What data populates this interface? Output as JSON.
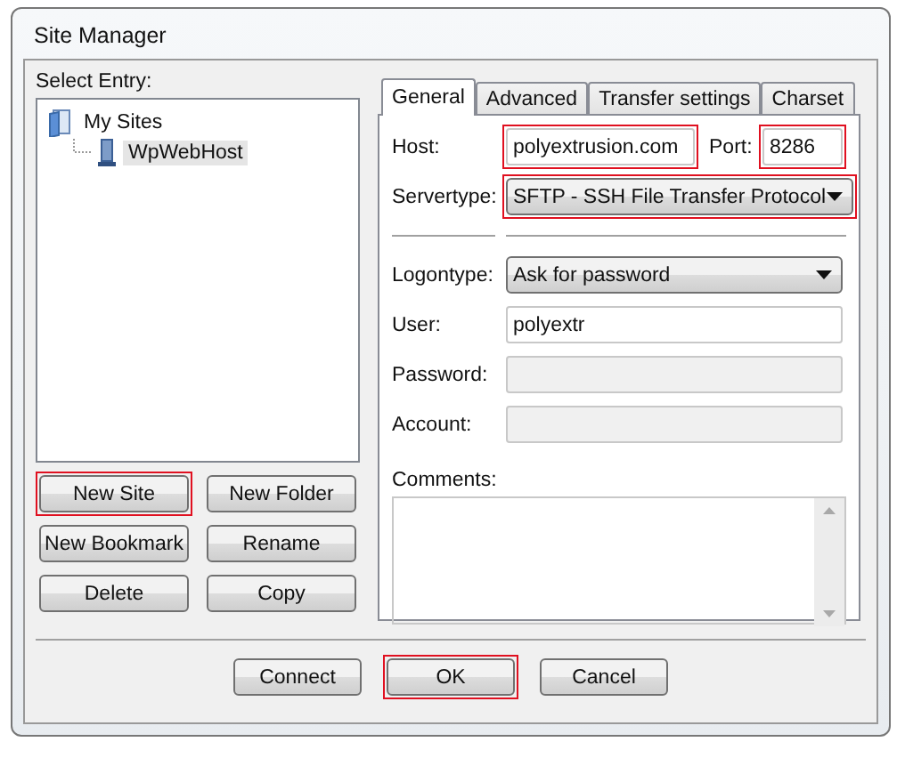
{
  "window": {
    "title": "Site Manager"
  },
  "entry_label": "Select Entry:",
  "tree": [
    {
      "label": "My Sites",
      "kind": "folder",
      "selected": false,
      "children": [
        {
          "label": "WpWebHost",
          "kind": "server",
          "selected": true
        }
      ]
    }
  ],
  "entry_buttons": [
    {
      "label": "New Site",
      "highlighted": true
    },
    {
      "label": "New Folder",
      "highlighted": false
    },
    {
      "label": "New Bookmark",
      "highlighted": false
    },
    {
      "label": "Rename",
      "highlighted": false
    },
    {
      "label": "Delete",
      "highlighted": false
    },
    {
      "label": "Copy",
      "highlighted": false
    }
  ],
  "tabs": [
    {
      "label": "General",
      "selected": true
    },
    {
      "label": "Advanced",
      "selected": false
    },
    {
      "label": "Transfer settings",
      "selected": false
    },
    {
      "label": "Charset",
      "selected": false
    }
  ],
  "general": {
    "host": {
      "label": "Host:",
      "value": "polyextrusion.com",
      "highlighted": true
    },
    "port": {
      "label": "Port:",
      "value": "8286",
      "highlighted": true
    },
    "servertype": {
      "label": "Servertype:",
      "value": "SFTP - SSH File Transfer Protocol",
      "highlighted": true
    },
    "logontype": {
      "label": "Logontype:",
      "value": "Ask for password",
      "highlighted": false
    },
    "user": {
      "label": "User:",
      "value": "polyextr",
      "disabled": false
    },
    "password": {
      "label": "Password:",
      "disabled": true
    },
    "account": {
      "label": "Account:",
      "disabled": true
    },
    "comments": {
      "label": "Comments:"
    }
  },
  "dialog_buttons": [
    {
      "label": "Connect",
      "highlighted": false
    },
    {
      "label": "OK",
      "highlighted": true
    },
    {
      "label": "Cancel",
      "highlighted": false
    }
  ]
}
